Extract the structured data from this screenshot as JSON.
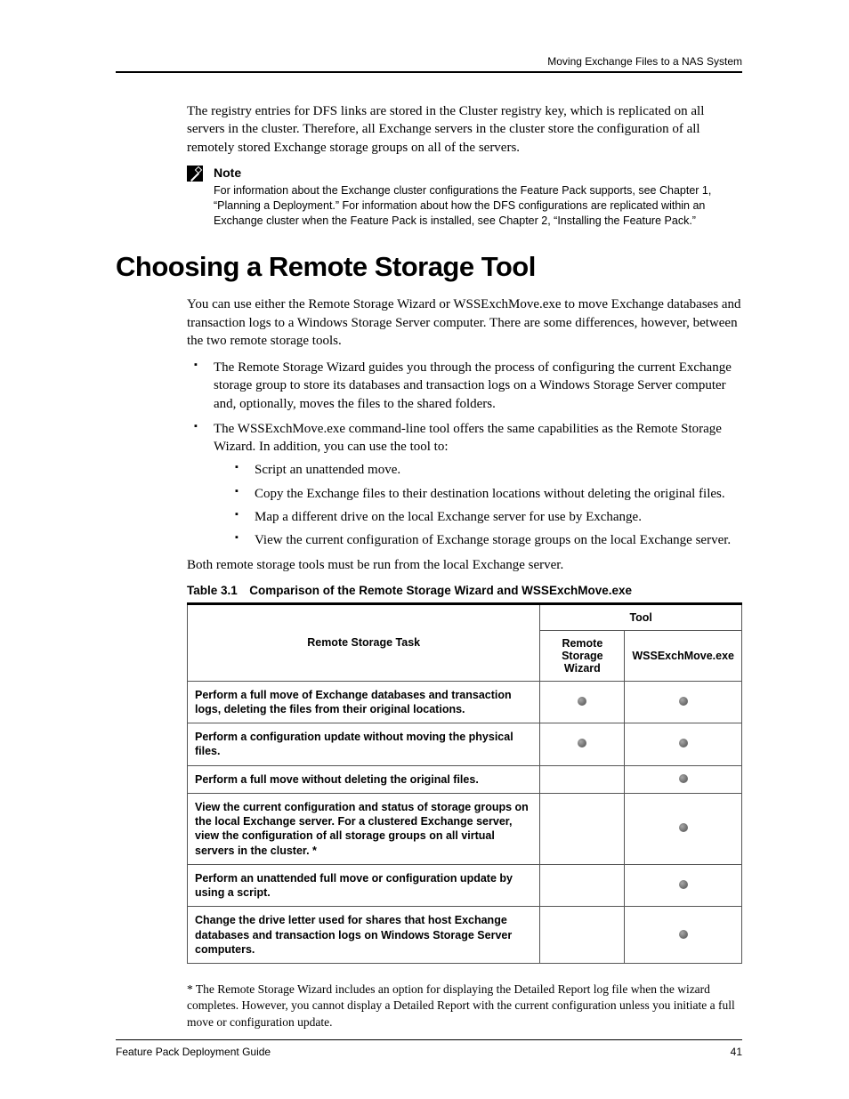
{
  "header": {
    "running": "Moving Exchange Files to a NAS System"
  },
  "intro_para": "The registry entries for DFS links are stored in the Cluster registry key, which is replicated on all servers in the cluster. Therefore, all Exchange servers in the cluster store the configuration of all remotely stored Exchange storage groups on all of the servers.",
  "note": {
    "label": "Note",
    "body": "For information about the Exchange cluster configurations the Feature Pack supports, see Chapter 1, “Planning a Deployment.” For information about how the DFS configurations are replicated within an Exchange cluster when the Feature Pack is installed, see Chapter 2, “Installing the Feature Pack.”"
  },
  "section_title": "Choosing a Remote Storage Tool",
  "section_intro": "You can use either the Remote Storage Wizard or WSSExchMove.exe to move Exchange databases and transaction logs to a Windows Storage Server computer. There are some differences, however, between the two remote storage tools.",
  "bullets": [
    "The Remote Storage Wizard guides you through the process of configuring the current Exchange storage group to store its databases and transaction logs on a Windows Storage Server computer and, optionally, moves the files to the shared folders.",
    "The WSSExchMove.exe command-line tool offers the same capabilities as the Remote Storage Wizard. In addition, you can use the tool to:"
  ],
  "sub_bullets": [
    "Script an unattended move.",
    "Copy the Exchange files to their destination locations without deleting the original files.",
    "Map a different drive on the local Exchange server for use by Exchange.",
    "View the current configuration of Exchange storage groups on the local Exchange server."
  ],
  "after_bullets": "Both remote storage tools must be run from the local Exchange server.",
  "table": {
    "caption": "Table 3.1 Comparison of the Remote Storage Wizard and WSSExchMove.exe",
    "col_task": "Remote Storage Task",
    "col_tool": "Tool",
    "col_a": "Remote Storage Wizard",
    "col_b": "WSSExchMove.exe",
    "rows": [
      {
        "task": "Perform a full move of Exchange databases and transaction logs, deleting the files from their original locations.",
        "a": true,
        "b": true
      },
      {
        "task": "Perform a configuration update without moving the physical files.",
        "a": true,
        "b": true
      },
      {
        "task": "Perform a full move without deleting the original files.",
        "a": false,
        "b": true
      },
      {
        "task": "View the current configuration and status of storage groups on the local Exchange server. For a clustered Exchange server, view the configuration of all storage groups on all virtual servers in the cluster. *",
        "a": false,
        "b": true
      },
      {
        "task": "Perform an unattended full move or configuration update by using a script.",
        "a": false,
        "b": true
      },
      {
        "task": "Change the drive letter used for shares that host Exchange databases and transaction logs on Windows Storage Server computers.",
        "a": false,
        "b": true
      }
    ]
  },
  "footnote": "*  The Remote Storage Wizard includes an option for displaying the Detailed Report log file when the wizard completes. However, you cannot display a Detailed Report with the current configuration unless you initiate a full move or configuration update.",
  "footer": {
    "left": "Feature Pack Deployment Guide",
    "right": "41"
  }
}
